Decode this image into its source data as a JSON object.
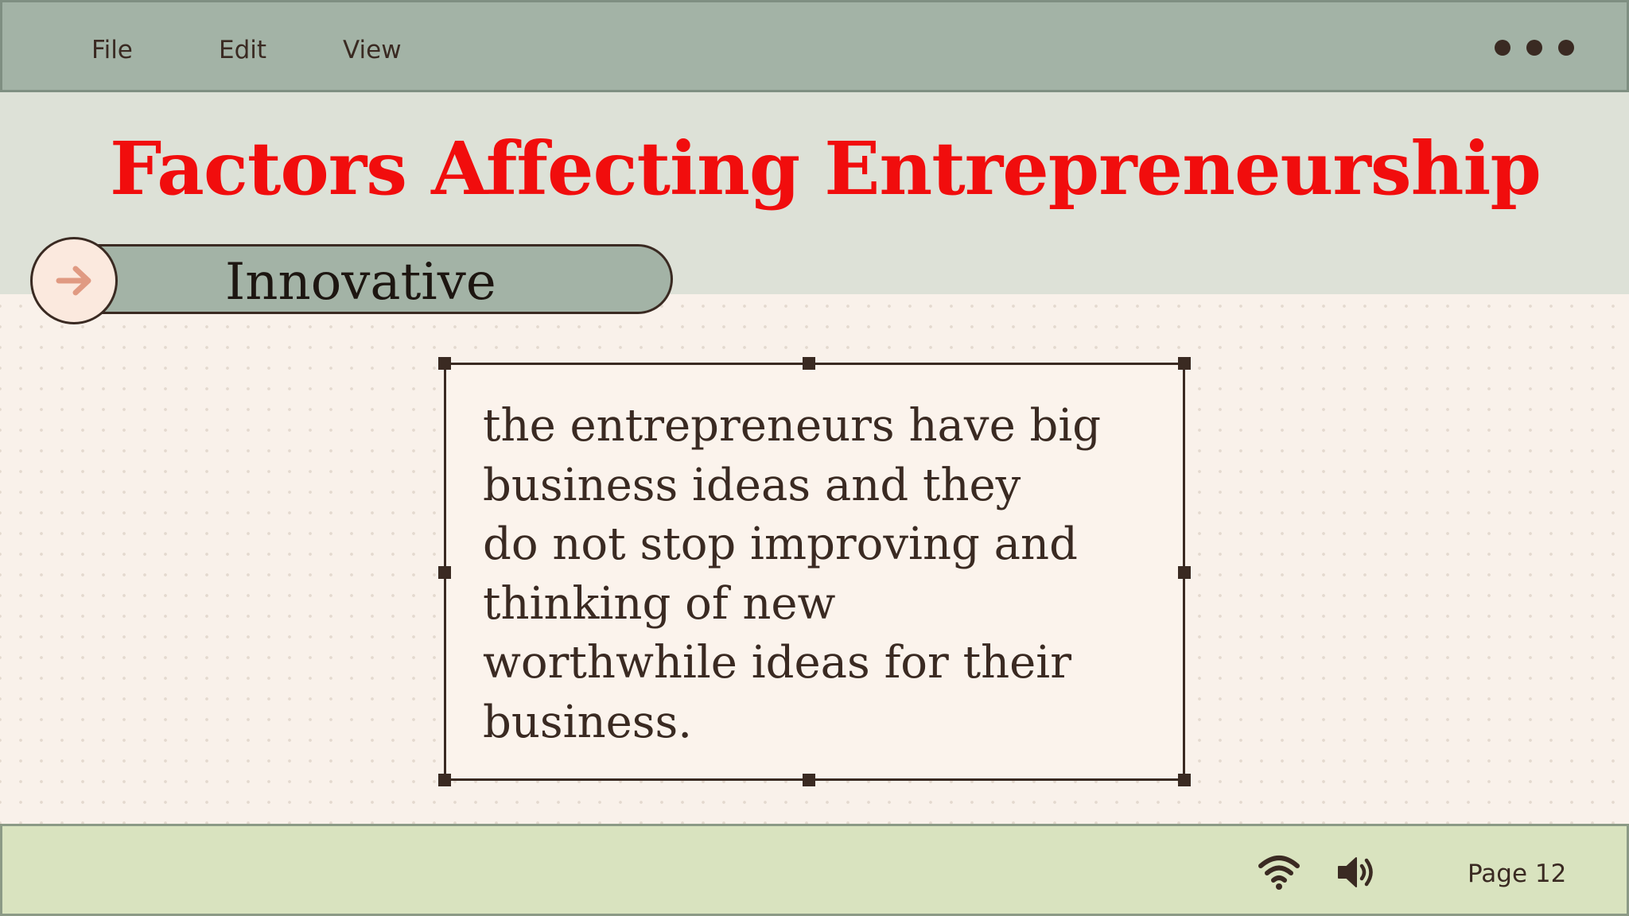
{
  "menu": {
    "file": "File",
    "edit": "Edit",
    "view": "View",
    "more_icon": "ellipsis-icon"
  },
  "slide": {
    "title": "Factors Affecting Entrepreneurship",
    "section_label": "Innovative",
    "section_icon": "arrow-right-icon",
    "body_text": "the entrepreneurs have big\nbusiness ideas and they\ndo not stop improving and\nthinking of new\nworthwhile ideas for their\nbusiness."
  },
  "status": {
    "wifi_icon": "wifi-icon",
    "volume_icon": "volume-icon",
    "page": "Page 12"
  },
  "colors": {
    "title": "#f10d0d",
    "menubar": "#a3b3a6",
    "header_band": "#dde1d7",
    "background": "#f9f1ea",
    "statusbar": "#d9e3bf",
    "ink": "#3a2a22",
    "arrow": "#e09a82"
  }
}
